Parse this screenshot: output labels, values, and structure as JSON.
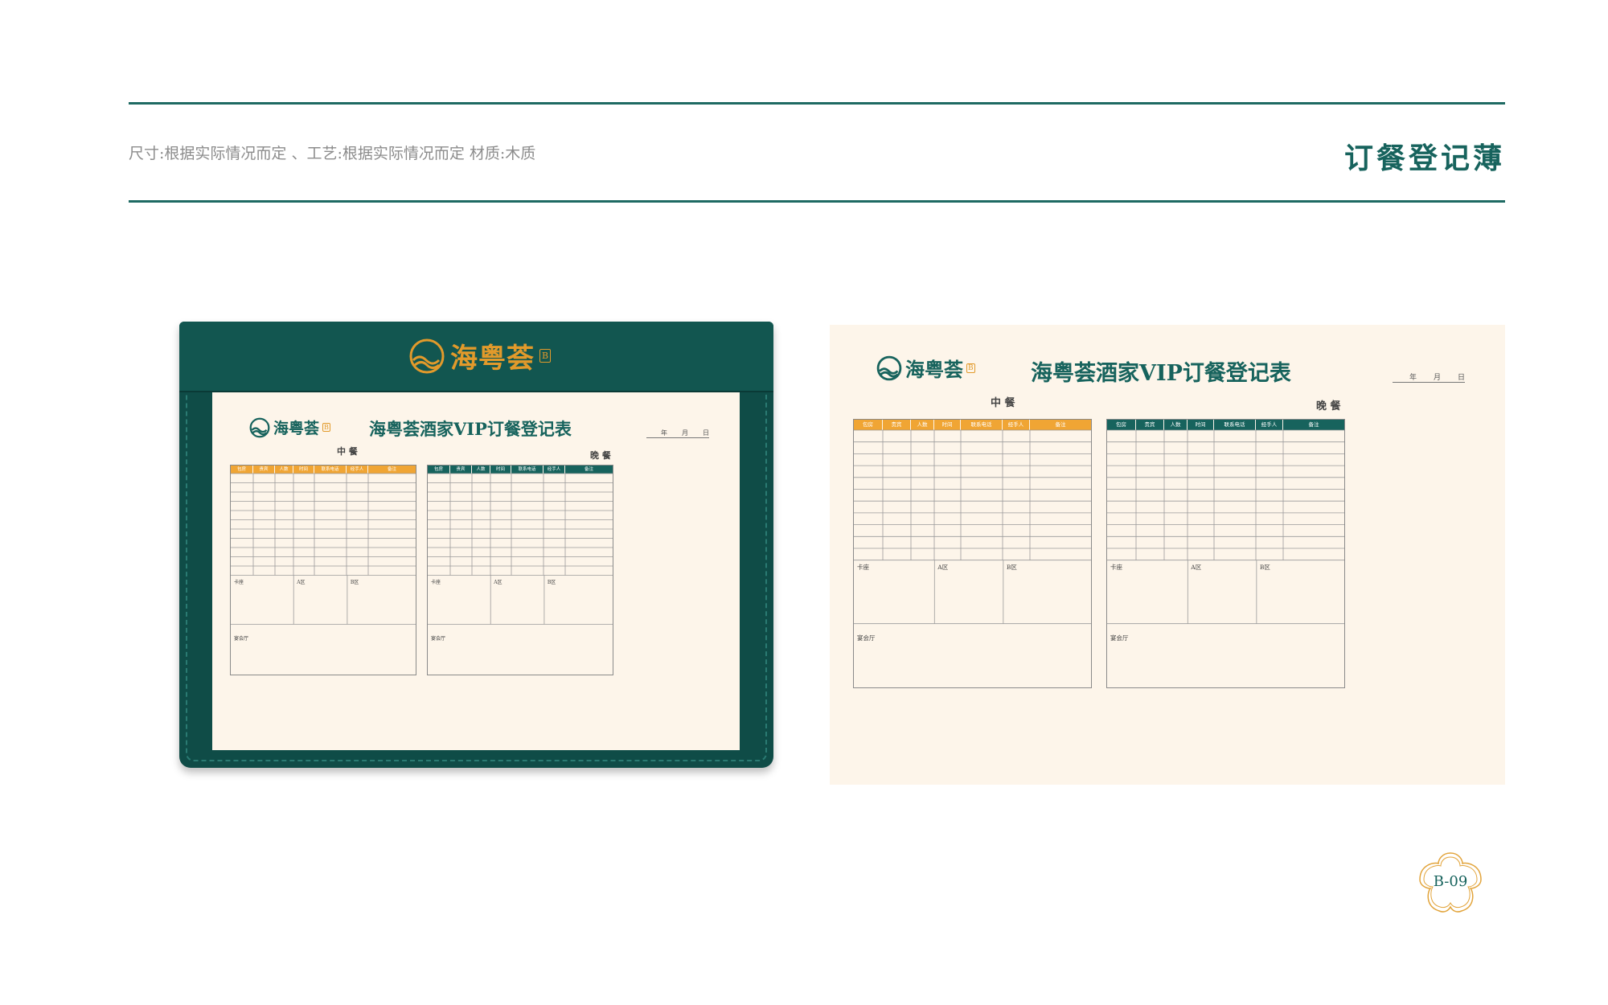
{
  "header": {
    "spec_text": "尺寸:根据实际情况而定 、工艺:根据实际情况而定  材质:木质",
    "title": "订餐登记薄"
  },
  "folder": {
    "logo_text": "海粤荟",
    "logo_tag": "B"
  },
  "sheet": {
    "logo_text": "海粤荟",
    "logo_tag": "B",
    "title": "海粤荟酒家VIP订餐登记表",
    "date_year": "年",
    "date_month": "月",
    "date_day": "日",
    "lunch_label": "中 餐",
    "dinner_label": "晚 餐",
    "columns": [
      "包房",
      "贵宾",
      "人数",
      "时间",
      "联系电话",
      "经手人",
      "备注"
    ],
    "zones": {
      "kazuo": "卡座",
      "a": "A区",
      "b": "B区",
      "banquet": "宴会厅"
    }
  },
  "colors": {
    "teal": "#17635d",
    "orange": "#f0a534",
    "paper": "#fdf5ea",
    "leather": "#0f4c47"
  },
  "page": {
    "code": "B-09"
  }
}
